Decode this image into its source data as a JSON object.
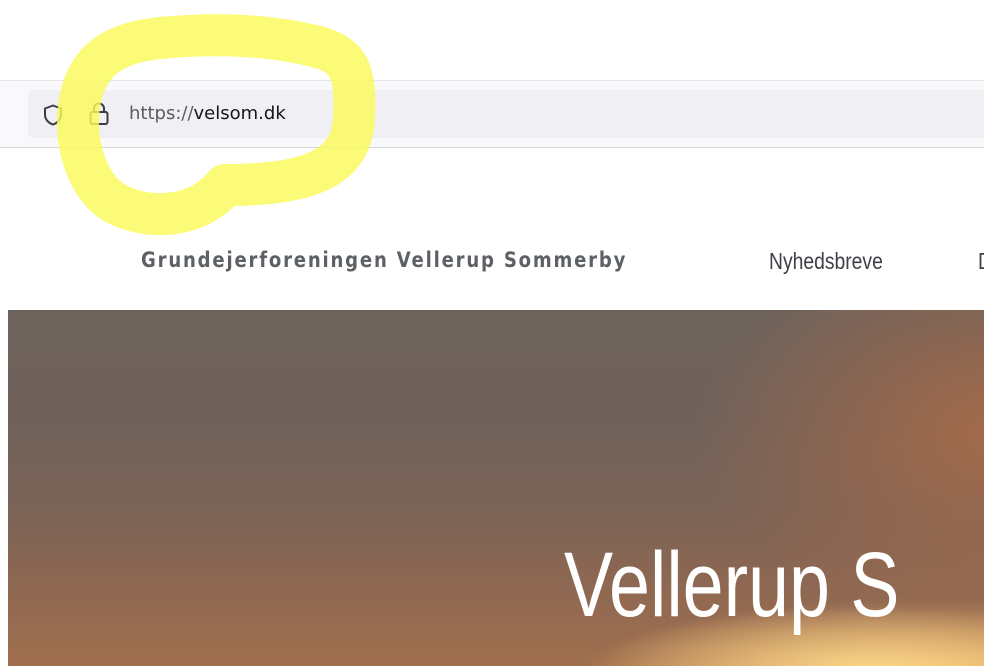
{
  "browser": {
    "url_scheme": "https://",
    "url_host": "velsom.dk",
    "icons": {
      "tracking_protection": "shield-icon",
      "connection_security": "lock-icon"
    }
  },
  "site": {
    "title": "Grundejerforeningen Vellerup Sommerby",
    "nav": [
      {
        "label": "Nyhedsbreve"
      },
      {
        "label": "D"
      }
    ],
    "hero_title": "Vellerup S"
  },
  "annotation": {
    "type": "freehand-highlight",
    "color": "#fbfa5a"
  }
}
